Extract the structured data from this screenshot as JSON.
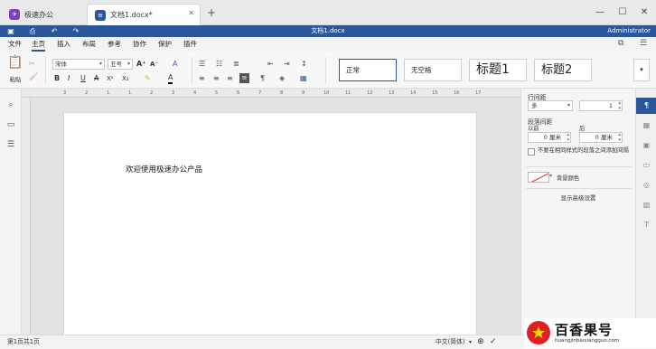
{
  "tabs": [
    {
      "label": "极速办公",
      "icon": "rocket-icon"
    },
    {
      "label": "文档1.docx*",
      "icon": "document-icon"
    }
  ],
  "new_tab_label": "+",
  "window_controls": {
    "minimize": "—",
    "maximize": "☐",
    "close": "✕"
  },
  "titlebar": {
    "title": "文档1.docx",
    "user": "Administrator"
  },
  "menu": {
    "items": [
      "文件",
      "主页",
      "插入",
      "布局",
      "参考",
      "协作",
      "保护",
      "插件"
    ],
    "active": "主页"
  },
  "ribbon": {
    "paste_label": "粘贴",
    "font_name": "宋体",
    "font_size": "五号",
    "bold": "B",
    "italic": "I",
    "underline": "U",
    "strike": "A",
    "superscript": "X²",
    "subscript": "X₂",
    "font_grow": "A⁺",
    "font_shrink": "A⁻",
    "font_color": "A",
    "styles": [
      "正常",
      "无空格",
      "标题1",
      "标题2"
    ],
    "active_style": "正常"
  },
  "document": {
    "text": "欢迎使用极速办公产品"
  },
  "ruler_numbers": [
    "3",
    "2",
    "1",
    "1",
    "2",
    "3",
    "4",
    "5",
    "6",
    "7",
    "8",
    "9",
    "10",
    "11",
    "12",
    "13",
    "14",
    "15",
    "16",
    "17"
  ],
  "panel": {
    "line_spacing_label": "行间距",
    "line_spacing_mode": "多",
    "line_spacing_value": "1",
    "paragraph_spacing_label": "段落间距",
    "before_label": "以前",
    "after_label": "后",
    "before_value": "0 厘米",
    "after_value": "0 厘米",
    "no_space_checkbox": "不要在相同样式的段落之间添加间隔",
    "background_color_label": "背景颜色",
    "advanced_settings": "显示高级设置"
  },
  "status": {
    "page": "第1页共1页",
    "language": "中文(简体)"
  },
  "watermark": {
    "brand": "百香果号",
    "url": "huangjinbaixiangguo.com"
  },
  "colors": {
    "accent": "#2b579a",
    "brand_red": "#e02020"
  }
}
